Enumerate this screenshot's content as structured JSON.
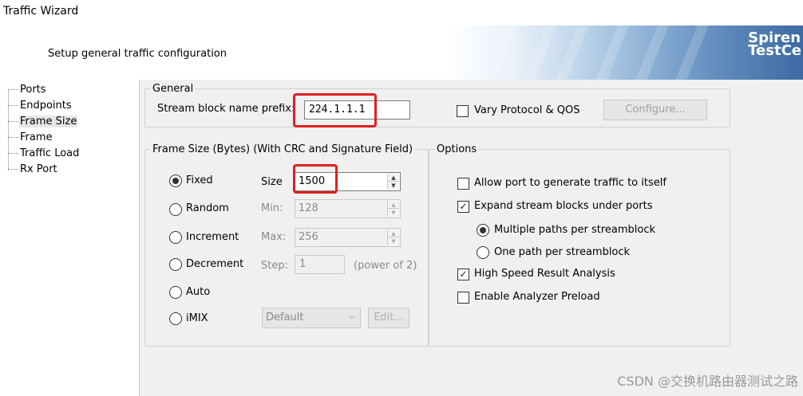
{
  "window": {
    "title": "Traffic Wizard"
  },
  "header": {
    "subtitle": "Setup general traffic configuration",
    "brand_line1": "Spiren",
    "brand_line2": "TestCe"
  },
  "nav": {
    "items": [
      "Ports",
      "Endpoints",
      "Frame Size",
      "Frame",
      "Traffic Load",
      "Rx Port"
    ],
    "selected": "Frame Size"
  },
  "general": {
    "legend": "General",
    "prefix_label": "Stream block name prefix:",
    "prefix_value": "224.1.1.1",
    "vary_label": "Vary Protocol & QOS",
    "vary_checked": false,
    "configure_label": "Configure..."
  },
  "frame_size": {
    "legend": "Frame Size (Bytes) (With CRC and Signature Field)",
    "modes": [
      "Fixed",
      "Random",
      "Increment",
      "Decrement",
      "Auto",
      "iMIX"
    ],
    "selected_mode": "Fixed",
    "size_label": "Size",
    "size_value": "1500",
    "min_label": "Min:",
    "min_value": "128",
    "max_label": "Max:",
    "max_value": "256",
    "step_label": "Step:",
    "step_value": "1",
    "step_hint": "(power of 2)",
    "imix_value": "Default",
    "edit_label": "Edit..."
  },
  "options": {
    "legend": "Options",
    "allow_self": {
      "label": "Allow port to generate traffic to itself",
      "checked": false
    },
    "expand": {
      "label": "Expand stream blocks under ports",
      "checked": true
    },
    "multiple_paths": {
      "label": "Multiple paths per streamblock",
      "selected": true
    },
    "one_path": {
      "label": "One path per streamblock",
      "selected": false
    },
    "high_speed": {
      "label": "High Speed Result Analysis",
      "checked": true
    },
    "preload": {
      "label": "Enable Analyzer Preload",
      "checked": false
    }
  },
  "watermark": "CSDN @交换机路由器测试之路",
  "colors": {
    "highlight_box": "#e02020",
    "banner_dark": "#3d6aa3"
  }
}
